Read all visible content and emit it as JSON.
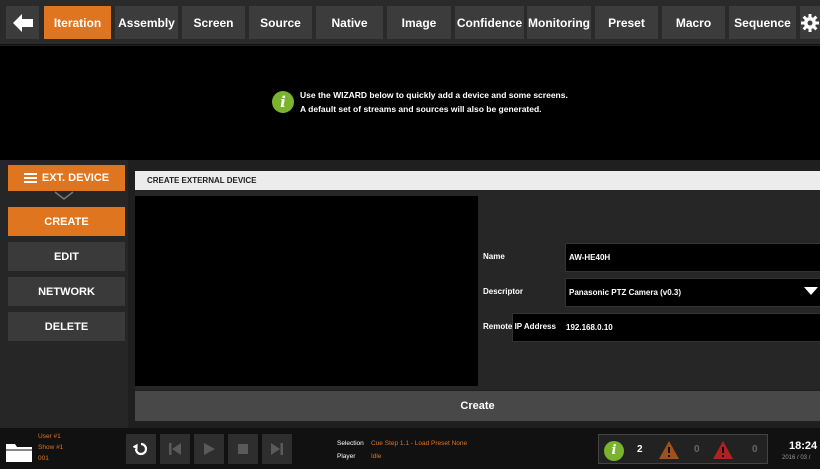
{
  "nav": {
    "tabs": [
      {
        "label": "Iteration",
        "active": true
      },
      {
        "label": "Assembly"
      },
      {
        "label": "Screen"
      },
      {
        "label": "Source"
      },
      {
        "label": "Native"
      },
      {
        "label": "Image"
      },
      {
        "label": "Confidence"
      },
      {
        "label": "Monitoring"
      },
      {
        "label": "Preset"
      },
      {
        "label": "Macro"
      },
      {
        "label": "Sequence"
      }
    ],
    "back_icon": "arrow-left-icon",
    "settings_icon": "gear-icon"
  },
  "banner": {
    "icon": "info-icon",
    "line1": "Use the WIZARD below to quickly add a device and some screens.",
    "line2": "A default set of streams and sources will also be generated."
  },
  "sidebar": {
    "header": "EXT. DEVICE",
    "items": [
      {
        "label": "CREATE",
        "active": true
      },
      {
        "label": "EDIT"
      },
      {
        "label": "NETWORK"
      },
      {
        "label": "DELETE"
      }
    ]
  },
  "form": {
    "title": "CREATE EXTERNAL DEVICE",
    "name_label": "Name",
    "name_value": "AW-HE40H",
    "descriptor_label": "Descriptor",
    "descriptor_value": "Panasonic PTZ Camera  (v0.3)",
    "ip_label": "Remote IP Address",
    "ip_value": "192.168.0.10",
    "create_label": "Create"
  },
  "status": {
    "user": "User #1",
    "show": "Show #1",
    "number": "001",
    "selection_label": "Selection",
    "selection_value": "Cue Step 1.1 - Load Preset None",
    "player_label": "Player",
    "player_value": "Idle",
    "info_count": "2",
    "warning_count": "0",
    "error_count": "0",
    "time": "18:24",
    "date": "2016 / 03 /"
  },
  "colors": {
    "accent": "#e0751f",
    "info": "#7ab42c",
    "warning": "#a0521c",
    "error": "#b02222"
  }
}
